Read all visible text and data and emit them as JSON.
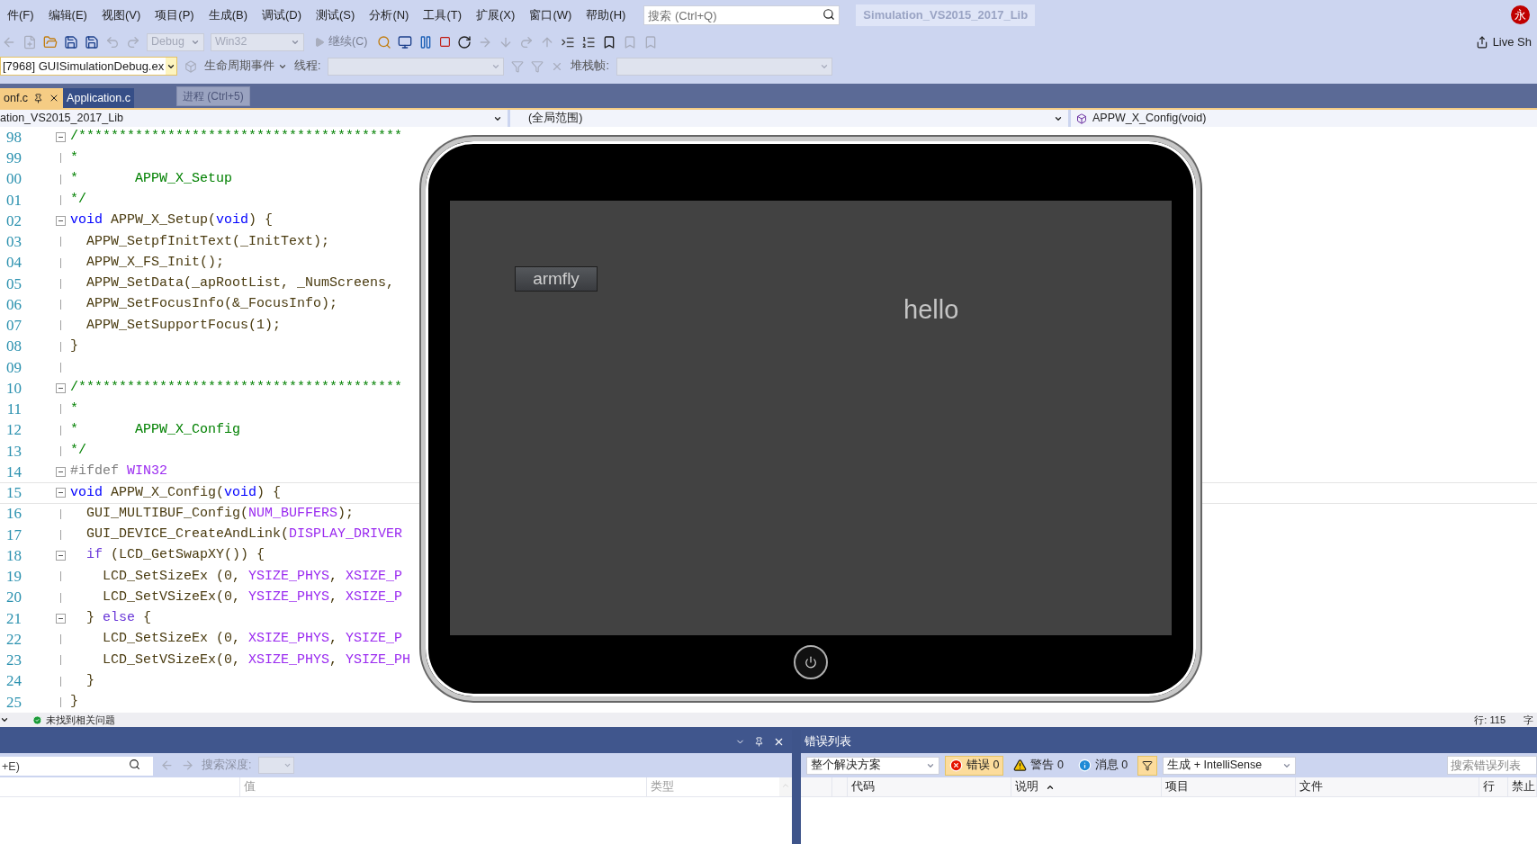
{
  "menu_bar": {
    "items": [
      "件(F)",
      "编辑(E)",
      "视图(V)",
      "项目(P)",
      "生成(B)",
      "调试(D)",
      "测试(S)",
      "分析(N)",
      "工具(T)",
      "扩展(X)",
      "窗口(W)",
      "帮助(H)"
    ],
    "search": {
      "placeholder": "搜索 (Ctrl+Q)"
    },
    "solution_title": "Simulation_VS2015_2017_Lib",
    "avatar": "永"
  },
  "toolbar": {
    "configuration": {
      "value": "Debug",
      "disabled": true
    },
    "platform": {
      "value": "Win32",
      "disabled": true
    },
    "continue_button": "继续(C)",
    "live_share": "Live Sh"
  },
  "debug_location": {
    "process": "[7968] GUISimulationDebug.ex",
    "lifecycle": "生命周期事件",
    "thread_label": "线程:",
    "stack_label": "堆栈帧:"
  },
  "tabs": [
    {
      "label": "onf.c",
      "selected": true
    },
    {
      "label": "Application.c",
      "selected": false
    }
  ],
  "tooltip": "进程 (Ctrl+5)",
  "navigation": {
    "project": "ation_VS2015_2017_Lib",
    "scope": "(全局范围)",
    "member": "APPW_X_Config(void)"
  },
  "editor": {
    "lines": [
      {
        "number": "98",
        "fold": true,
        "current": false,
        "tokens": [
          {
            "kind": "comment",
            "text": "/****************************************"
          }
        ]
      },
      {
        "number": "99",
        "fold": false,
        "current": false,
        "tokens": [
          {
            "kind": "comment",
            "text": "*"
          }
        ]
      },
      {
        "number": "00",
        "fold": false,
        "current": false,
        "tokens": [
          {
            "kind": "comment",
            "text": "*       APPW_X_Setup"
          }
        ]
      },
      {
        "number": "01",
        "fold": false,
        "current": false,
        "tokens": [
          {
            "kind": "comment",
            "text": "*/"
          }
        ]
      },
      {
        "number": "02",
        "fold": true,
        "current": false,
        "tokens": [
          {
            "kind": "keyword",
            "text": "void"
          },
          {
            "kind": "plain",
            "text": " APPW_X_Setup("
          },
          {
            "kind": "keyword",
            "text": "void"
          },
          {
            "kind": "plain",
            "text": ") {"
          }
        ]
      },
      {
        "number": "03",
        "fold": false,
        "current": false,
        "tokens": [
          {
            "kind": "plain",
            "text": "  APPW_SetpfInitText(_InitText);"
          }
        ]
      },
      {
        "number": "04",
        "fold": false,
        "current": false,
        "tokens": [
          {
            "kind": "plain",
            "text": "  APPW_X_FS_Init();"
          }
        ]
      },
      {
        "number": "05",
        "fold": false,
        "current": false,
        "tokens": [
          {
            "kind": "plain",
            "text": "  APPW_SetData(_apRootList, _NumScreens,"
          }
        ]
      },
      {
        "number": "06",
        "fold": false,
        "current": false,
        "tokens": [
          {
            "kind": "plain",
            "text": "  APPW_SetFocusInfo(&_FocusInfo);"
          }
        ]
      },
      {
        "number": "07",
        "fold": false,
        "current": false,
        "tokens": [
          {
            "kind": "plain",
            "text": "  APPW_SetSupportFocus(1);"
          }
        ]
      },
      {
        "number": "08",
        "fold": false,
        "current": false,
        "tokens": [
          {
            "kind": "plain",
            "text": "}"
          }
        ]
      },
      {
        "number": "09",
        "fold": false,
        "current": false
      },
      {
        "number": "10",
        "fold": true,
        "current": false,
        "tokens": [
          {
            "kind": "comment",
            "text": "/****************************************"
          }
        ]
      },
      {
        "number": "11",
        "fold": false,
        "current": false,
        "tokens": [
          {
            "kind": "comment",
            "text": "*"
          }
        ]
      },
      {
        "number": "12",
        "fold": false,
        "current": false,
        "tokens": [
          {
            "kind": "comment",
            "text": "*       APPW_X_Config"
          }
        ]
      },
      {
        "number": "13",
        "fold": false,
        "current": false,
        "tokens": [
          {
            "kind": "comment",
            "text": "*/"
          }
        ]
      },
      {
        "number": "14",
        "fold": true,
        "current": false,
        "tokens": [
          {
            "kind": "preproc",
            "text": "#ifdef "
          },
          {
            "kind": "macro",
            "text": "WIN32"
          }
        ]
      },
      {
        "number": "15",
        "fold": true,
        "current": true,
        "tokens": [
          {
            "kind": "keyword",
            "text": "void"
          },
          {
            "kind": "plain",
            "text": " APPW_X_Config("
          },
          {
            "kind": "keyword",
            "text": "void"
          },
          {
            "kind": "plain",
            "text": ") {"
          }
        ]
      },
      {
        "number": "16",
        "fold": false,
        "current": false,
        "tokens": [
          {
            "kind": "plain",
            "text": "  GUI_MULTIBUF_Config("
          },
          {
            "kind": "macro",
            "text": "NUM_BUFFERS"
          },
          {
            "kind": "plain",
            "text": ");"
          }
        ]
      },
      {
        "number": "17",
        "fold": false,
        "current": false,
        "tokens": [
          {
            "kind": "plain",
            "text": "  GUI_DEVICE_CreateAndLink("
          },
          {
            "kind": "macro",
            "text": "DISPLAY_DRIVER"
          }
        ]
      },
      {
        "number": "18",
        "fold": true,
        "current": false,
        "tokens": [
          {
            "kind": "control",
            "text": "  if"
          },
          {
            "kind": "plain",
            "text": " (LCD_GetSwapXY()) {"
          }
        ]
      },
      {
        "number": "19",
        "fold": false,
        "current": false,
        "tokens": [
          {
            "kind": "plain",
            "text": "    LCD_SetSizeEx (0, "
          },
          {
            "kind": "macro",
            "text": "YSIZE_PHYS"
          },
          {
            "kind": "plain",
            "text": ", "
          },
          {
            "kind": "macro",
            "text": "XSIZE_P"
          }
        ]
      },
      {
        "number": "20",
        "fold": false,
        "current": false,
        "tokens": [
          {
            "kind": "plain",
            "text": "    LCD_SetVSizeEx(0, "
          },
          {
            "kind": "macro",
            "text": "YSIZE_PHYS"
          },
          {
            "kind": "plain",
            "text": ", "
          },
          {
            "kind": "macro",
            "text": "XSIZE_P"
          }
        ]
      },
      {
        "number": "21",
        "fold": true,
        "current": false,
        "tokens": [
          {
            "kind": "plain",
            "text": "  } "
          },
          {
            "kind": "control",
            "text": "else"
          },
          {
            "kind": "plain",
            "text": " {"
          }
        ]
      },
      {
        "number": "22",
        "fold": false,
        "current": false,
        "tokens": [
          {
            "kind": "plain",
            "text": "    LCD_SetSizeEx (0, "
          },
          {
            "kind": "macro",
            "text": "XSIZE_PHYS"
          },
          {
            "kind": "plain",
            "text": ", "
          },
          {
            "kind": "macro",
            "text": "YSIZE_P"
          }
        ]
      },
      {
        "number": "23",
        "fold": false,
        "current": false,
        "tokens": [
          {
            "kind": "plain",
            "text": "    LCD_SetVSizeEx(0, "
          },
          {
            "kind": "macro",
            "text": "XSIZE_PHYS"
          },
          {
            "kind": "plain",
            "text": ", "
          },
          {
            "kind": "macro",
            "text": "YSIZE_PH"
          }
        ]
      },
      {
        "number": "24",
        "fold": false,
        "current": false,
        "tokens": [
          {
            "kind": "plain",
            "text": "  }"
          }
        ]
      },
      {
        "number": "25",
        "fold": false,
        "current": false,
        "tokens": [
          {
            "kind": "plain",
            "text": "}"
          }
        ]
      }
    ]
  },
  "simulator": {
    "button": "armfly",
    "label": "hello"
  },
  "status_bar": {
    "issues": "未找到相关问题",
    "line": "行: 115",
    "column": "字"
  },
  "locals_panel": {
    "search": {
      "placeholder": "+E)"
    },
    "depth_label": "搜索深度:",
    "columns": [
      "值",
      "类型"
    ]
  },
  "error_list": {
    "title": "错误列表",
    "scope": "整个解决方案",
    "filters": [
      {
        "kind": "error",
        "label": "错误 0",
        "selected": true
      },
      {
        "kind": "warning",
        "label": "警告 0",
        "selected": false
      },
      {
        "kind": "message",
        "label": "消息 0",
        "selected": false
      }
    ],
    "filter_active": true,
    "build_filter": "生成 + IntelliSense",
    "search": {
      "placeholder": "搜索错误列表"
    },
    "columns": [
      {
        "label": "代码",
        "sorted": false
      },
      {
        "label": "说明",
        "sorted": true
      },
      {
        "label": "项目",
        "sorted": false
      },
      {
        "label": "文件",
        "sorted": false
      },
      {
        "label": "行",
        "sorted": false
      },
      {
        "label": "禁止",
        "sorted": false
      }
    ]
  }
}
